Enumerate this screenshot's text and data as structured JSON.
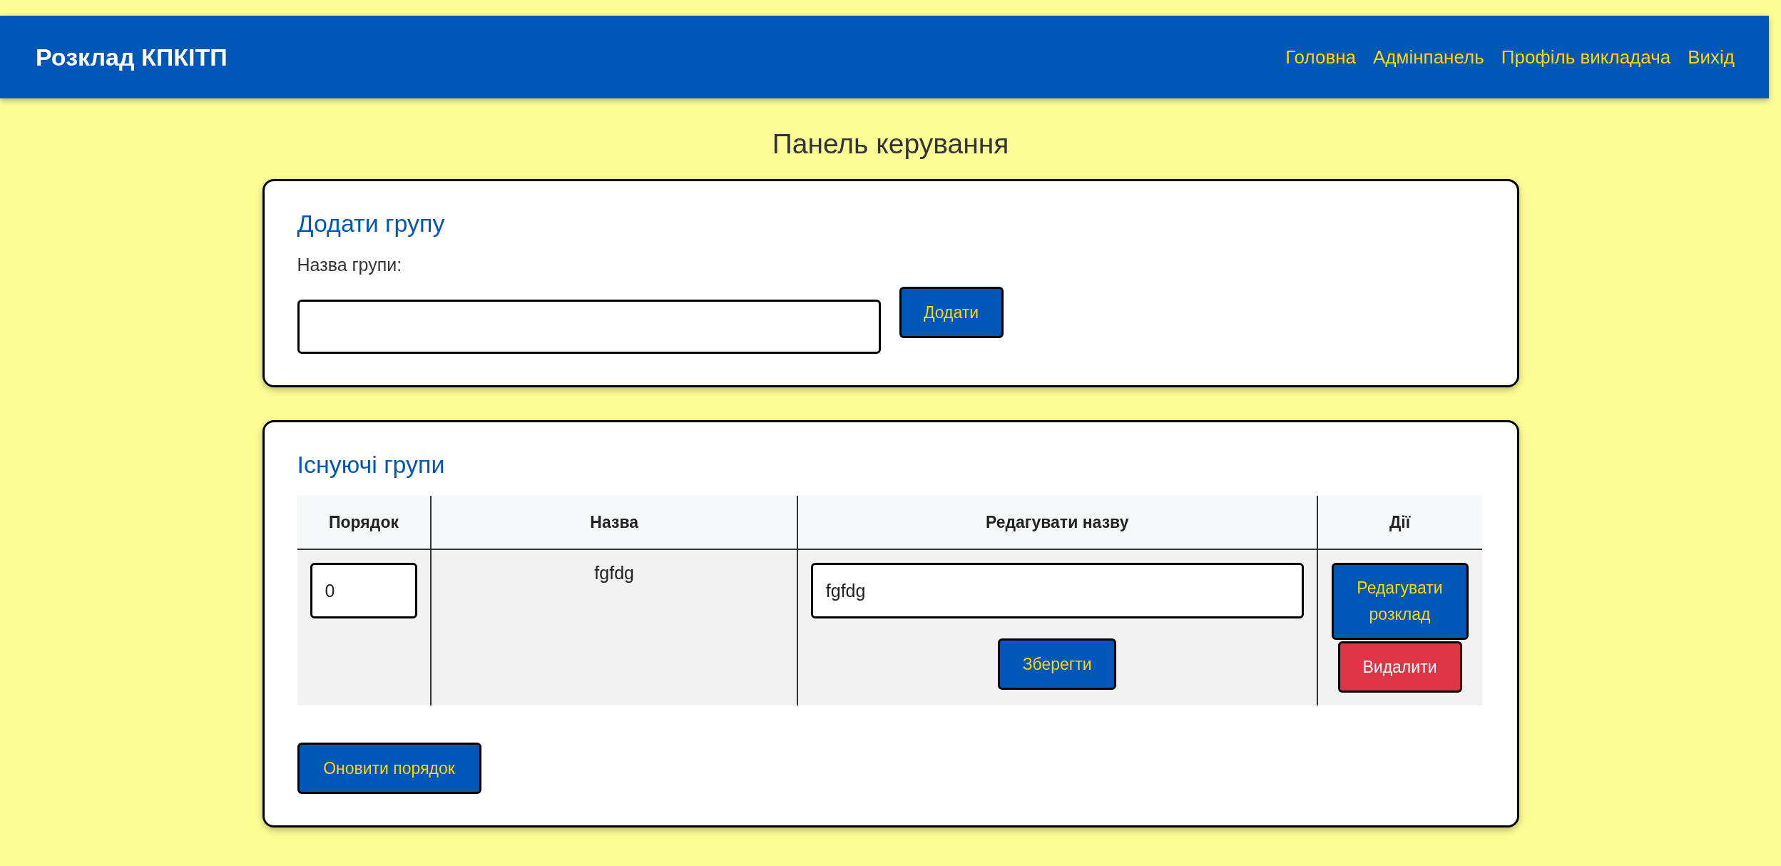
{
  "header": {
    "title": "Розклад КПКІТП",
    "nav": [
      "Головна",
      "Адмінпанель",
      "Профіль викладача",
      "Вихід"
    ]
  },
  "page_title": "Панель керування",
  "add_group": {
    "title": "Додати групу",
    "label": "Назва групи:",
    "button": "Додати"
  },
  "groups": {
    "title": "Існуючі групи",
    "columns": [
      "Порядок",
      "Назва",
      "Редагувати назву",
      "Дії"
    ],
    "rows": [
      {
        "order": "0",
        "name": "fgfdg",
        "edit_value": "fgfdg",
        "save_button": "Зберегти",
        "actions": [
          {
            "kind": "edit",
            "label": "Редагувати розклад"
          },
          {
            "kind": "delete",
            "label": "Видалити"
          }
        ]
      }
    ],
    "update_button": "Оновити порядок"
  }
}
